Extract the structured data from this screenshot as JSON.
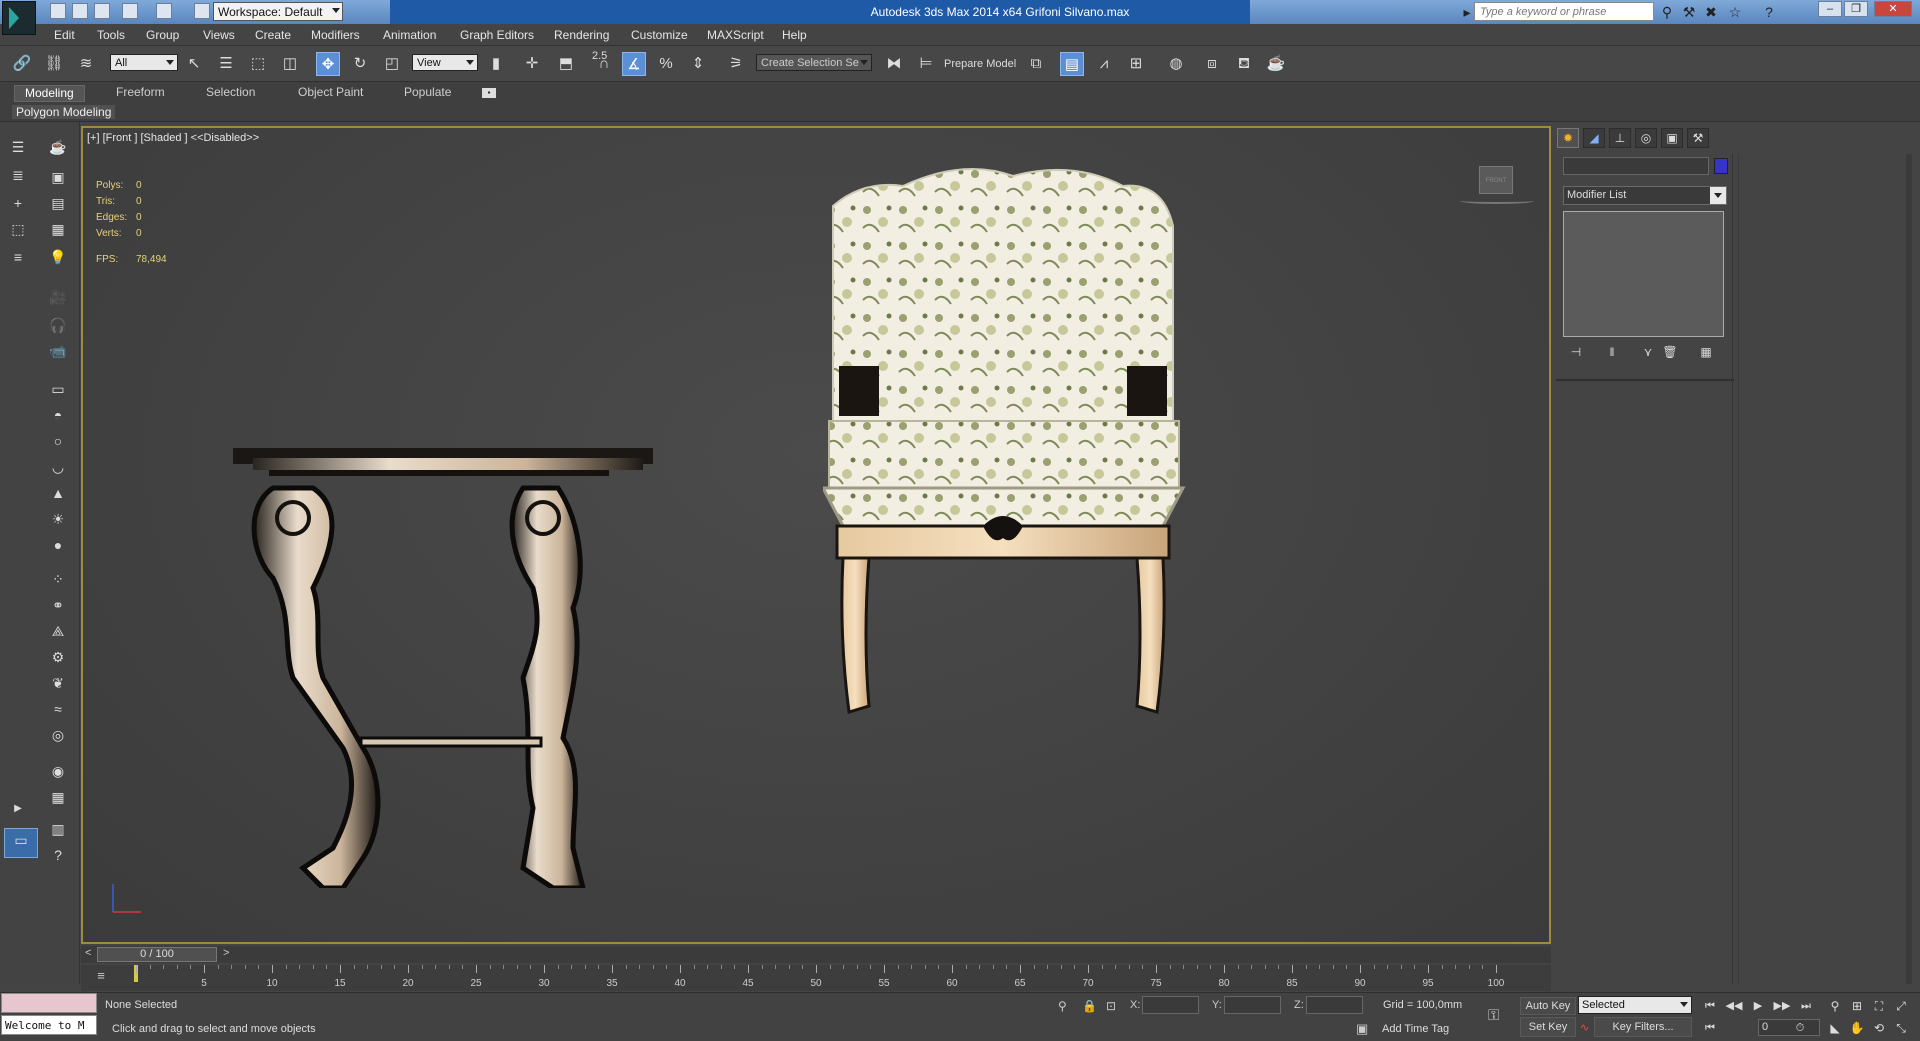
{
  "window": {
    "title": "Autodesk 3ds Max  2014 x64    Grifoni Silvano.max",
    "workspace": "Workspace: Default",
    "search_placeholder": "Type a keyword or phrase"
  },
  "menu": [
    "Edit",
    "Tools",
    "Group",
    "Views",
    "Create",
    "Modifiers",
    "Animation",
    "Graph Editors",
    "Rendering",
    "Customize",
    "MAXScript",
    "Help"
  ],
  "toolbar": {
    "selection_filter": "All",
    "ref_coord": "View",
    "snap_value": "2.5",
    "named_selection": "Create Selection Se",
    "prepare_model": "Prepare Model"
  },
  "ribbon": {
    "tabs": [
      "Modeling",
      "Freeform",
      "Selection",
      "Object Paint",
      "Populate"
    ],
    "active_tab": "Modeling",
    "panel_label": "Polygon Modeling"
  },
  "viewport": {
    "label": "[+] [Front ] [Shaded ]  <<Disabled>>",
    "stats": [
      {
        "label": "Polys:",
        "value": "0"
      },
      {
        "label": "Tris:",
        "value": "0"
      },
      {
        "label": "Edges:",
        "value": "0"
      },
      {
        "label": "Verts:",
        "value": "0"
      }
    ],
    "fps_label": "FPS:",
    "fps_value": "78,494",
    "viewcube_label": "FRONT"
  },
  "command_panel": {
    "modifier_list": "Modifier List",
    "object_color": "#3732c8"
  },
  "timeline": {
    "frame_display": "0 / 100",
    "ticks": [
      0,
      5,
      10,
      15,
      20,
      25,
      30,
      35,
      40,
      45,
      50,
      55,
      60,
      65,
      70,
      75,
      80,
      85,
      90,
      95,
      100
    ],
    "labels": [
      "5",
      "10",
      "15",
      "20",
      "25",
      "30",
      "35",
      "40",
      "45",
      "50",
      "55",
      "60",
      "65",
      "70",
      "75",
      "80",
      "85",
      "90",
      "95",
      "100"
    ]
  },
  "status": {
    "welcome": "Welcome to M",
    "selection": "None Selected",
    "prompt": "Click and drag to select and move objects",
    "x_label": "X:",
    "y_label": "Y:",
    "z_label": "Z:",
    "grid": "Grid = 100,0mm",
    "add_time_tag": "Add Time Tag",
    "auto_key": "Auto Key",
    "set_key": "Set Key",
    "key_mode": "Selected",
    "key_filters": "Key Filters...",
    "current_frame": "0"
  },
  "colors": {
    "viewport_border": "#a08a3c",
    "active_tool": "#5b8fd6",
    "stats_text": "#e8d27a",
    "title_bar": "#1e5aa6"
  }
}
